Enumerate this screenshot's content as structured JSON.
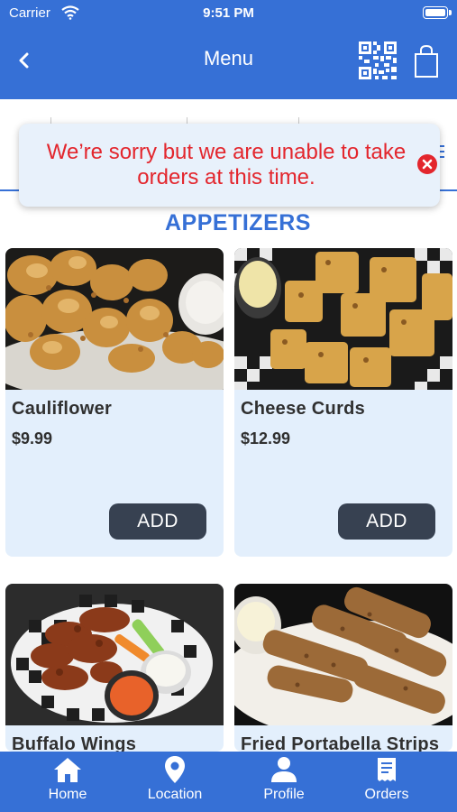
{
  "status_bar": {
    "carrier": "Carrier",
    "time": "9:51 PM"
  },
  "nav": {
    "title": "Menu",
    "back_icon": "chevron-left-icon",
    "qr_icon": "qr-code-icon",
    "cart_icon": "shopping-bag-icon"
  },
  "alert": {
    "message": "We’re sorry but we are unable to take orders at this time.",
    "close_icon": "close-circle-icon",
    "color": "#e3262d"
  },
  "section": {
    "title": "APPETIZERS"
  },
  "items": [
    {
      "name": "Cauliflower",
      "price": "$9.99",
      "add_label": "ADD"
    },
    {
      "name": "Cheese Curds",
      "price": "$12.99",
      "add_label": "ADD"
    },
    {
      "name": "Buffalo Wings"
    },
    {
      "name": "Fried Portabella Strips"
    }
  ],
  "tabs": [
    {
      "label": "Home",
      "icon": "home-icon"
    },
    {
      "label": "Location",
      "icon": "map-pin-icon"
    },
    {
      "label": "Profile",
      "icon": "user-icon"
    },
    {
      "label": "Orders",
      "icon": "receipt-icon"
    }
  ],
  "colors": {
    "brand": "#3670d6",
    "card_bg": "#e3effc",
    "button": "#374151"
  }
}
